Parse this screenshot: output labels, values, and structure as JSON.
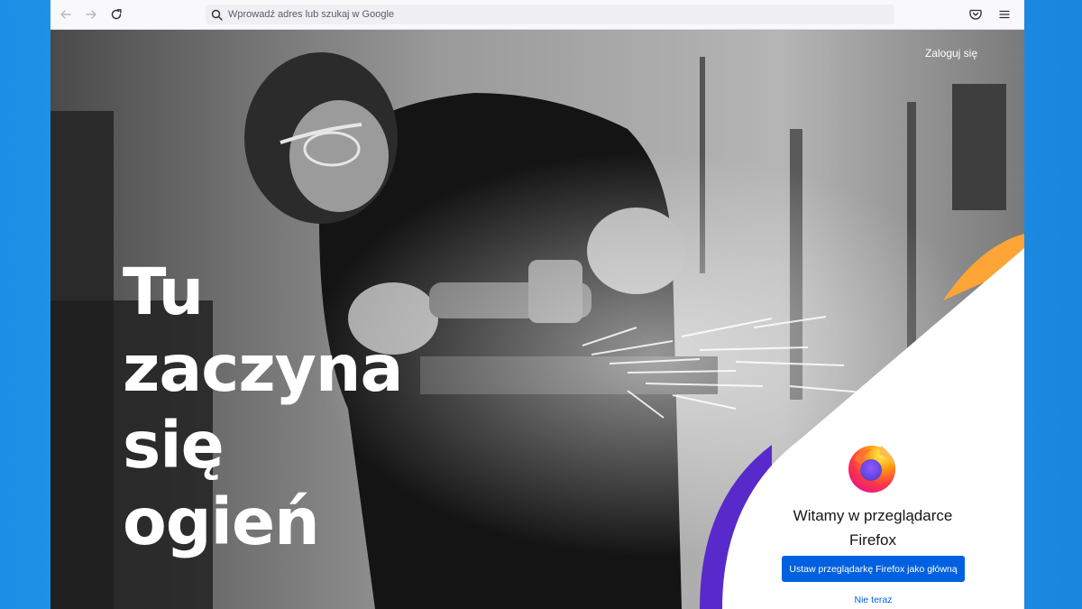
{
  "toolbar": {
    "back_icon": "arrow-left-icon",
    "forward_icon": "arrow-right-icon",
    "reload_icon": "reload-icon",
    "search_icon": "search-icon",
    "address_placeholder": "Wprowadź adres lub szukaj w Google",
    "pocket_icon": "pocket-icon",
    "menu_icon": "hamburger-menu-icon"
  },
  "page": {
    "signin_label": "Zaloguj się",
    "headline": [
      "Tu",
      "zaczyna",
      "się",
      "ogień"
    ],
    "welcome_title": "Witamy w przeglądarce Firefox",
    "primary_button": "Ustaw przeglądarkę Firefox jako główną",
    "secondary_link": "Nie teraz",
    "logo_icon": "firefox-logo-icon"
  },
  "colors": {
    "desktop": "#1e8fe6",
    "primary_button": "#0061e0",
    "accent_orange": "#ffa436",
    "accent_purple": "#592acb"
  }
}
